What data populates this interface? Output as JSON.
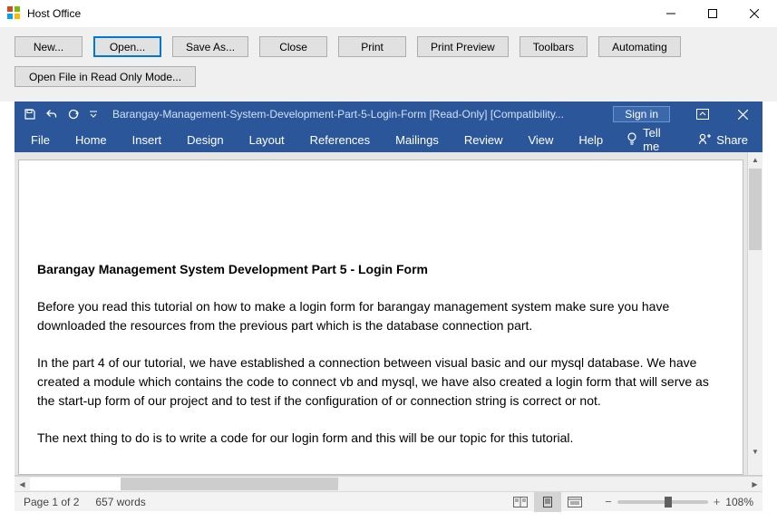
{
  "host": {
    "title": "Host Office",
    "buttons_row1": [
      "New...",
      "Open...",
      "Save As...",
      "Close",
      "Print",
      "Print Preview",
      "Toolbars",
      "Automating"
    ],
    "active_row1_index": 1,
    "buttons_row2": [
      "Open File in Read Only Mode..."
    ]
  },
  "word": {
    "doc_title": "Barangay-Management-System-Development-Part-5-Login-Form [Read-Only] [Compatibility...",
    "signin": "Sign in",
    "tabs": [
      "File",
      "Home",
      "Insert",
      "Design",
      "Layout",
      "References",
      "Mailings",
      "Review",
      "View",
      "Help"
    ],
    "tellme": "Tell me",
    "share": "Share"
  },
  "document": {
    "heading": "Barangay Management System Development Part 5 - Login Form",
    "p1": "Before you read this tutorial on how to make a login form for barangay management system make sure you have downloaded the resources from the previous part which is the database connection part.",
    "p2": "In the part 4 of our tutorial, we have established a connection between visual basic and our mysql database. We have created a module which contains the code to connect vb and mysql, we have also created a login form that will serve as the start-up form of our project and to test if the configuration of or connection string is correct or not.",
    "p3": "The next thing to do is to write a code for our login form and this will be our topic for this tutorial."
  },
  "status": {
    "page": "Page 1 of 2",
    "words": "657 words",
    "zoom": "108%"
  }
}
